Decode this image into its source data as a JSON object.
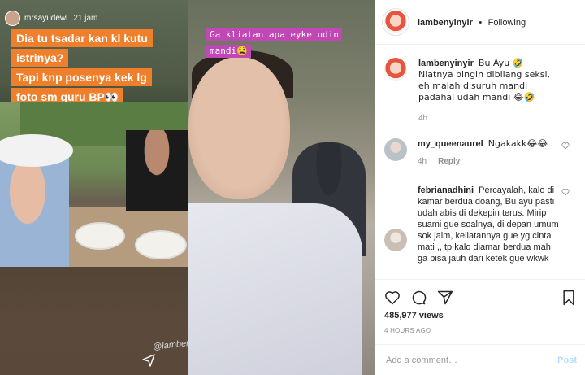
{
  "media": {
    "story1": {
      "username": "mrsayudewi",
      "time": "21 jam",
      "caption_lines": [
        "Dia tu tsadar kan kl kutu",
        "istrinya?",
        "Tapi knp posenya kek lg",
        "foto sm guru BP👀"
      ],
      "watermark": "@lambenyinyir"
    },
    "story2": {
      "caption_lines": [
        "Ga kliatan apa eyke udin",
        "mandi😫"
      ]
    }
  },
  "header": {
    "username": "lambenyinyir",
    "separator": "•",
    "follow_status": "Following"
  },
  "comments": [
    {
      "username": "lambenyinyir",
      "text": "Bu Ayu 🤣 Niatnya pingin dibilang seksi, eh malah disuruh mandi padahal udah mandi 😂🤣",
      "time": "4h",
      "reply": "",
      "avatar_color": "#e8553f"
    },
    {
      "username": "my_queenaurel",
      "text": "Ngakakk😂😂",
      "time": "4h",
      "reply": "Reply",
      "avatar_color": "#b9c2c8"
    },
    {
      "username": "febrianadhini",
      "text": "Percayalah, kalo di kamar berdua doang, Bu ayu pasti udah abis di dekepin terus. Mirip suami gue soalnya, di depan umum sok jaim, keliatannya gue yg cinta mati ,, tp kalo diamar berdua mah ga bisa jauh dari ketek gue wkwk",
      "time": "",
      "reply": "",
      "avatar_color": "#c9bfb4"
    }
  ],
  "actions": {
    "views": "485,977 views",
    "timestamp": "4 HOURS AGO"
  },
  "add_comment": {
    "placeholder": "Add a comment…",
    "post_label": "Post"
  }
}
